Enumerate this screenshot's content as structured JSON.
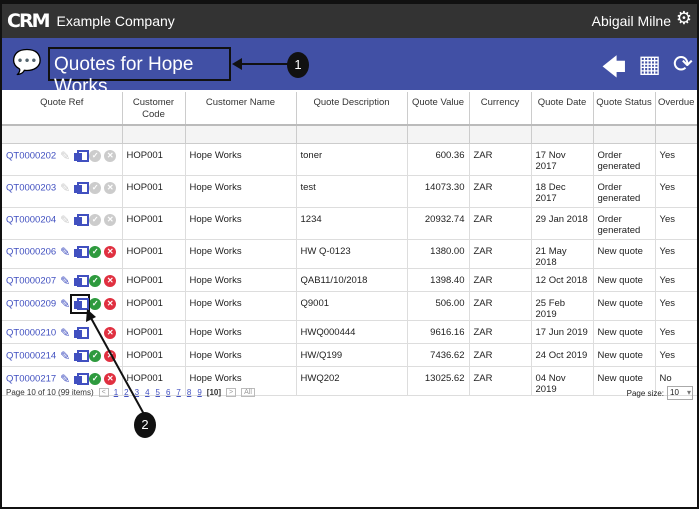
{
  "header": {
    "logo": "CRM",
    "company": "Example Company",
    "user": "Abigail Milne",
    "settings_icon": "gear-icon"
  },
  "titlebar": {
    "title": "Quotes for Hope Works",
    "icons": [
      "chat-icon",
      "back-arrow-icon",
      "building-icon",
      "refresh-icon"
    ]
  },
  "callouts": [
    "1",
    "2"
  ],
  "table": {
    "columns": [
      "Quote Ref",
      "Customer Code",
      "Customer Name",
      "Quote Description",
      "Quote Value",
      "Currency",
      "Quote Date",
      "Quote Status",
      "Overdue"
    ],
    "rows": [
      {
        "ref": "QT0000202",
        "code": "HOP001",
        "name": "Hope Works",
        "desc": "toner",
        "value": "600.36",
        "currency": "ZAR",
        "date": "17 Nov 2017",
        "status": "Order generated",
        "overdue": "Yes",
        "active": false
      },
      {
        "ref": "QT0000203",
        "code": "HOP001",
        "name": "Hope Works",
        "desc": "test",
        "value": "14073.30",
        "currency": "ZAR",
        "date": "18 Dec 2017",
        "status": "Order generated",
        "overdue": "Yes",
        "active": false
      },
      {
        "ref": "QT0000204",
        "code": "HOP001",
        "name": "Hope Works",
        "desc": "1234",
        "value": "20932.74",
        "currency": "ZAR",
        "date": "29 Jan 2018",
        "status": "Order generated",
        "overdue": "Yes",
        "active": false
      },
      {
        "ref": "QT0000206",
        "code": "HOP001",
        "name": "Hope Works",
        "desc": "HW Q-0123",
        "value": "1380.00",
        "currency": "ZAR",
        "date": "21 May 2018",
        "status": "New quote",
        "overdue": "Yes",
        "active": true
      },
      {
        "ref": "QT0000207",
        "code": "HOP001",
        "name": "Hope Works",
        "desc": "QAB11/10/2018",
        "value": "1398.40",
        "currency": "ZAR",
        "date": "12 Oct 2018",
        "status": "New quote",
        "overdue": "Yes",
        "active": true
      },
      {
        "ref": "QT0000209",
        "code": "HOP001",
        "name": "Hope Works",
        "desc": "Q9001",
        "value": "506.00",
        "currency": "ZAR",
        "date": "25 Feb 2019",
        "status": "New quote",
        "overdue": "Yes",
        "active": true
      },
      {
        "ref": "QT0000210",
        "code": "HOP001",
        "name": "Hope Works",
        "desc": "HWQ000444",
        "value": "9616.16",
        "currency": "ZAR",
        "date": "17 Jun 2019",
        "status": "New quote",
        "overdue": "Yes",
        "active": true
      },
      {
        "ref": "QT0000214",
        "code": "HOP001",
        "name": "Hope Works",
        "desc": "HW/Q199",
        "value": "7436.62",
        "currency": "ZAR",
        "date": "24 Oct 2019",
        "status": "New quote",
        "overdue": "Yes",
        "active": true
      },
      {
        "ref": "QT0000217",
        "code": "HOP001",
        "name": "Hope Works",
        "desc": "HWQ202",
        "value": "13025.62",
        "currency": "ZAR",
        "date": "04 Nov 2019",
        "status": "New quote",
        "overdue": "No",
        "active": true
      }
    ]
  },
  "pager": {
    "summary": "Page 10 of 10 (99 items)",
    "pages": [
      "1",
      "2",
      "3",
      "4",
      "5",
      "6",
      "7",
      "8",
      "9"
    ],
    "current": "[10]",
    "all": "All",
    "page_size_label": "Page size:",
    "page_size": "10"
  }
}
